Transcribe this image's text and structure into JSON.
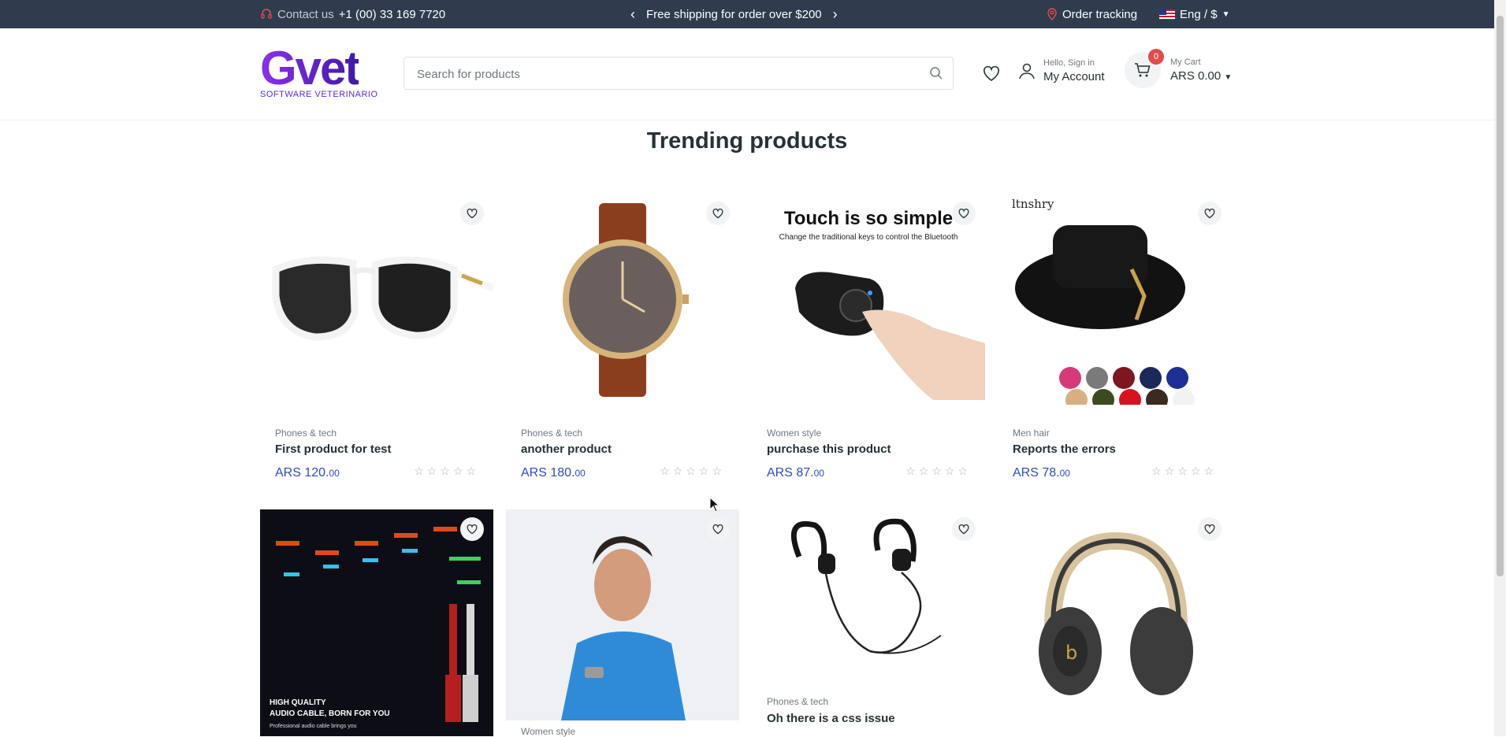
{
  "topbar": {
    "contact_label": "Contact us",
    "phone": "+1 (00) 33 169 7720",
    "promo": "Free shipping for order over $200",
    "order_tracking": "Order tracking",
    "lang_currency": "Eng / $"
  },
  "header": {
    "logo_text": "Gvet",
    "logo_sub": "SOFTWARE VETERINARIO",
    "search_placeholder": "Search for products",
    "account_greeting": "Hello, Sign in",
    "account_label": "My Account",
    "cart_label": "My Cart",
    "cart_total": "ARS 0.00",
    "cart_count": "0"
  },
  "section_title": "Trending products",
  "products": [
    {
      "category": "Phones & tech",
      "name": "First product for test",
      "price_main": "ARS 120.",
      "price_cents": "00"
    },
    {
      "category": "Phones & tech",
      "name": "another product",
      "price_main": "ARS 180.",
      "price_cents": "00"
    },
    {
      "category": "Women style",
      "name": "purchase this product",
      "price_main": "ARS 87.",
      "price_cents": "00",
      "image_text": {
        "title": "Touch is so simple",
        "sub": "Change the traditional keys to control the Bluetooth"
      }
    },
    {
      "category": "Men hair",
      "name": "Reports the errors",
      "price_main": "ARS 78.",
      "price_cents": "00",
      "image_text": {
        "brand": "ltnshry"
      }
    },
    {
      "category": "",
      "name": "",
      "image_text": {
        "line1": "HIGH QUALITY",
        "line2": "AUDIO CABLE, BORN FOR YOU",
        "line3": "Professional audio cable brings you"
      }
    },
    {
      "category": "Women style",
      "name": ""
    },
    {
      "category": "Phones & tech",
      "name": "Oh there is a css issue"
    },
    {
      "category": "",
      "name": ""
    }
  ],
  "colors": {
    "topbar": "#2f3c4e",
    "price": "#2f4bc2",
    "badge": "#e24c4b",
    "brand": "#7b2ce6"
  }
}
